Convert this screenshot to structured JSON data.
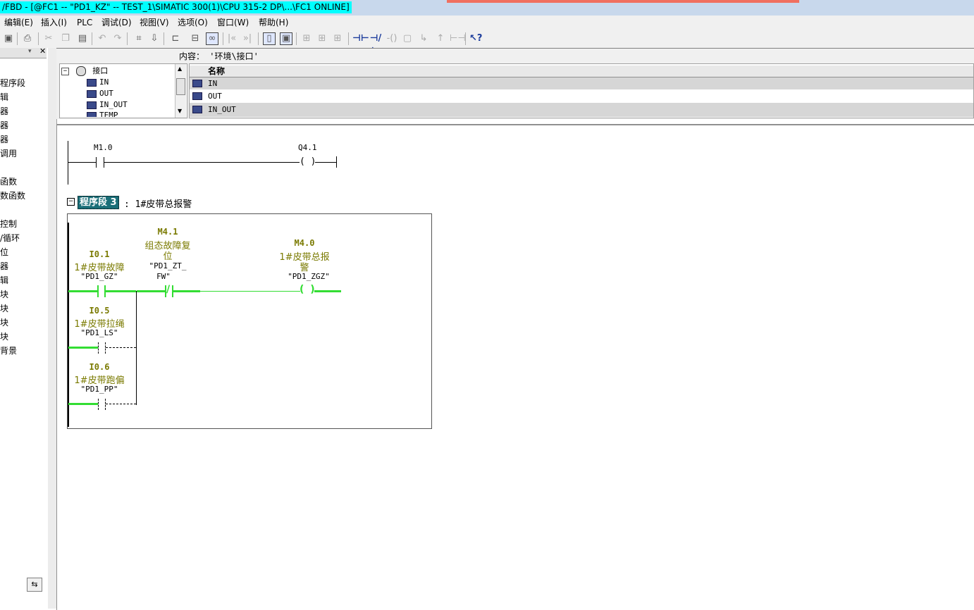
{
  "window": {
    "title": "/FBD  - [@FC1 -- \"PD1_KZ\" -- TEST_1\\SIMATIC 300(1)\\CPU 315-2 DP\\...\\FC1  ONLINE]"
  },
  "menu": {
    "items": [
      "编辑(E)",
      "插入(I)",
      "PLC",
      "调试(D)",
      "视图(V)",
      "选项(O)",
      "窗口(W)",
      "帮助(H)"
    ]
  },
  "left_panel": {
    "items": [
      "程序段",
      "辑",
      "器",
      "器",
      "器",
      "调用",
      "函数",
      "数函数",
      "控制",
      "/循环",
      "位",
      "器",
      "辑",
      "块",
      "块",
      "块",
      "块",
      "背景"
    ],
    "bottom_icon": "tree-toggle-icon"
  },
  "interface": {
    "content_label": "内容：  '环境\\接口'",
    "tree": {
      "root": "接口",
      "children": [
        "IN",
        "OUT",
        "IN_OUT",
        "TEMP"
      ]
    },
    "list": {
      "header": "名称",
      "rows": [
        "IN",
        "OUT",
        "IN_OUT"
      ]
    }
  },
  "network1": {
    "contact_addr": "M1.0",
    "coil_addr": "Q4.1"
  },
  "network2": {
    "label": "程序段 3",
    "title": ": 1#皮带总报警",
    "contacts": [
      {
        "addr": "I0.1",
        "comment": "1#皮带故障",
        "symbol": "\"PD1_GZ\""
      },
      {
        "addr": "I0.5",
        "comment": "1#皮带拉绳",
        "symbol": "\"PD1_LS\""
      },
      {
        "addr": "I0.6",
        "comment": "1#皮带跑偏",
        "symbol": "\"PD1_PP\""
      }
    ],
    "nc_contact": {
      "addr": "M4.1",
      "comment_l1": "组态故障复",
      "comment_l2": "位",
      "symbol_l1": "\"PD1_ZT_",
      "symbol_l2": "FW\""
    },
    "coil": {
      "addr": "M4.0",
      "comment_l1": "1#皮带总报",
      "comment_l2": "警",
      "symbol": "\"PD1_ZGZ\""
    }
  },
  "colors": {
    "power_flow": "#33dd33",
    "title_highlight": "#00ffff",
    "network_label_bg": "#1a6e78",
    "address_olive": "#7a7a00"
  }
}
